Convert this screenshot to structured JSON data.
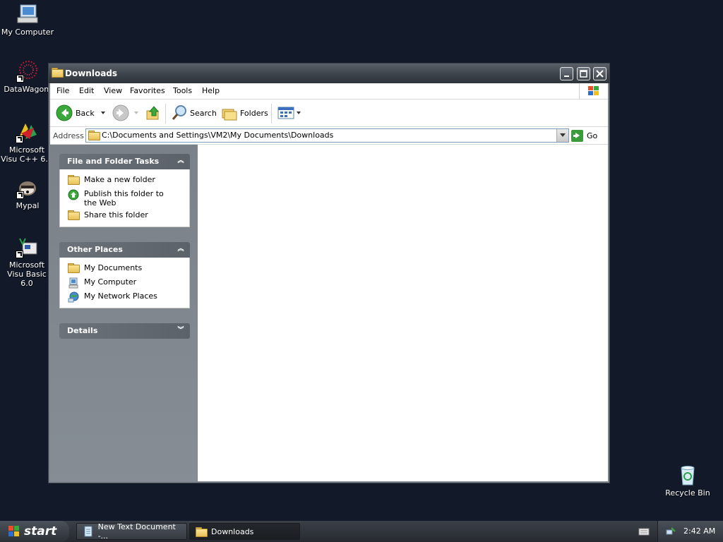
{
  "desktop": {
    "icons": [
      {
        "label": "My Computer",
        "icon": "my-computer-icon"
      },
      {
        "label": "DataWagon.",
        "icon": "datawagon-icon"
      },
      {
        "label": "Microsoft Visu C++ 6.0",
        "icon": "visual-cpp-icon"
      },
      {
        "label": "Mypal",
        "icon": "mypal-icon"
      },
      {
        "label": "Microsoft Visu Basic 6.0",
        "icon": "visual-basic-icon"
      },
      {
        "label": "Recycle Bin",
        "icon": "recycle-bin-icon"
      }
    ]
  },
  "window": {
    "title": "Downloads",
    "menu": [
      "File",
      "Edit",
      "View",
      "Favorites",
      "Tools",
      "Help"
    ],
    "toolbar": {
      "back": "Back",
      "search": "Search",
      "folders": "Folders"
    },
    "address": {
      "label": "Address",
      "path": "C:\\Documents and Settings\\VM2\\My Documents\\Downloads",
      "go": "Go"
    }
  },
  "taskpane": {
    "file_tasks": {
      "title": "File and Folder Tasks",
      "items": [
        "Make a new folder",
        "Publish this folder to the Web",
        "Share this folder"
      ]
    },
    "other_places": {
      "title": "Other Places",
      "items": [
        "My Documents",
        "My Computer",
        "My Network Places"
      ]
    },
    "details": {
      "title": "Details"
    }
  },
  "taskbar": {
    "start": "start",
    "buttons": [
      "New Text Document -...",
      "Downloads"
    ],
    "clock": "2:42 AM"
  },
  "colors": {
    "desktop": "#121a2a",
    "taskpane": "#7e858e",
    "go_green": "#3b9b3b"
  }
}
